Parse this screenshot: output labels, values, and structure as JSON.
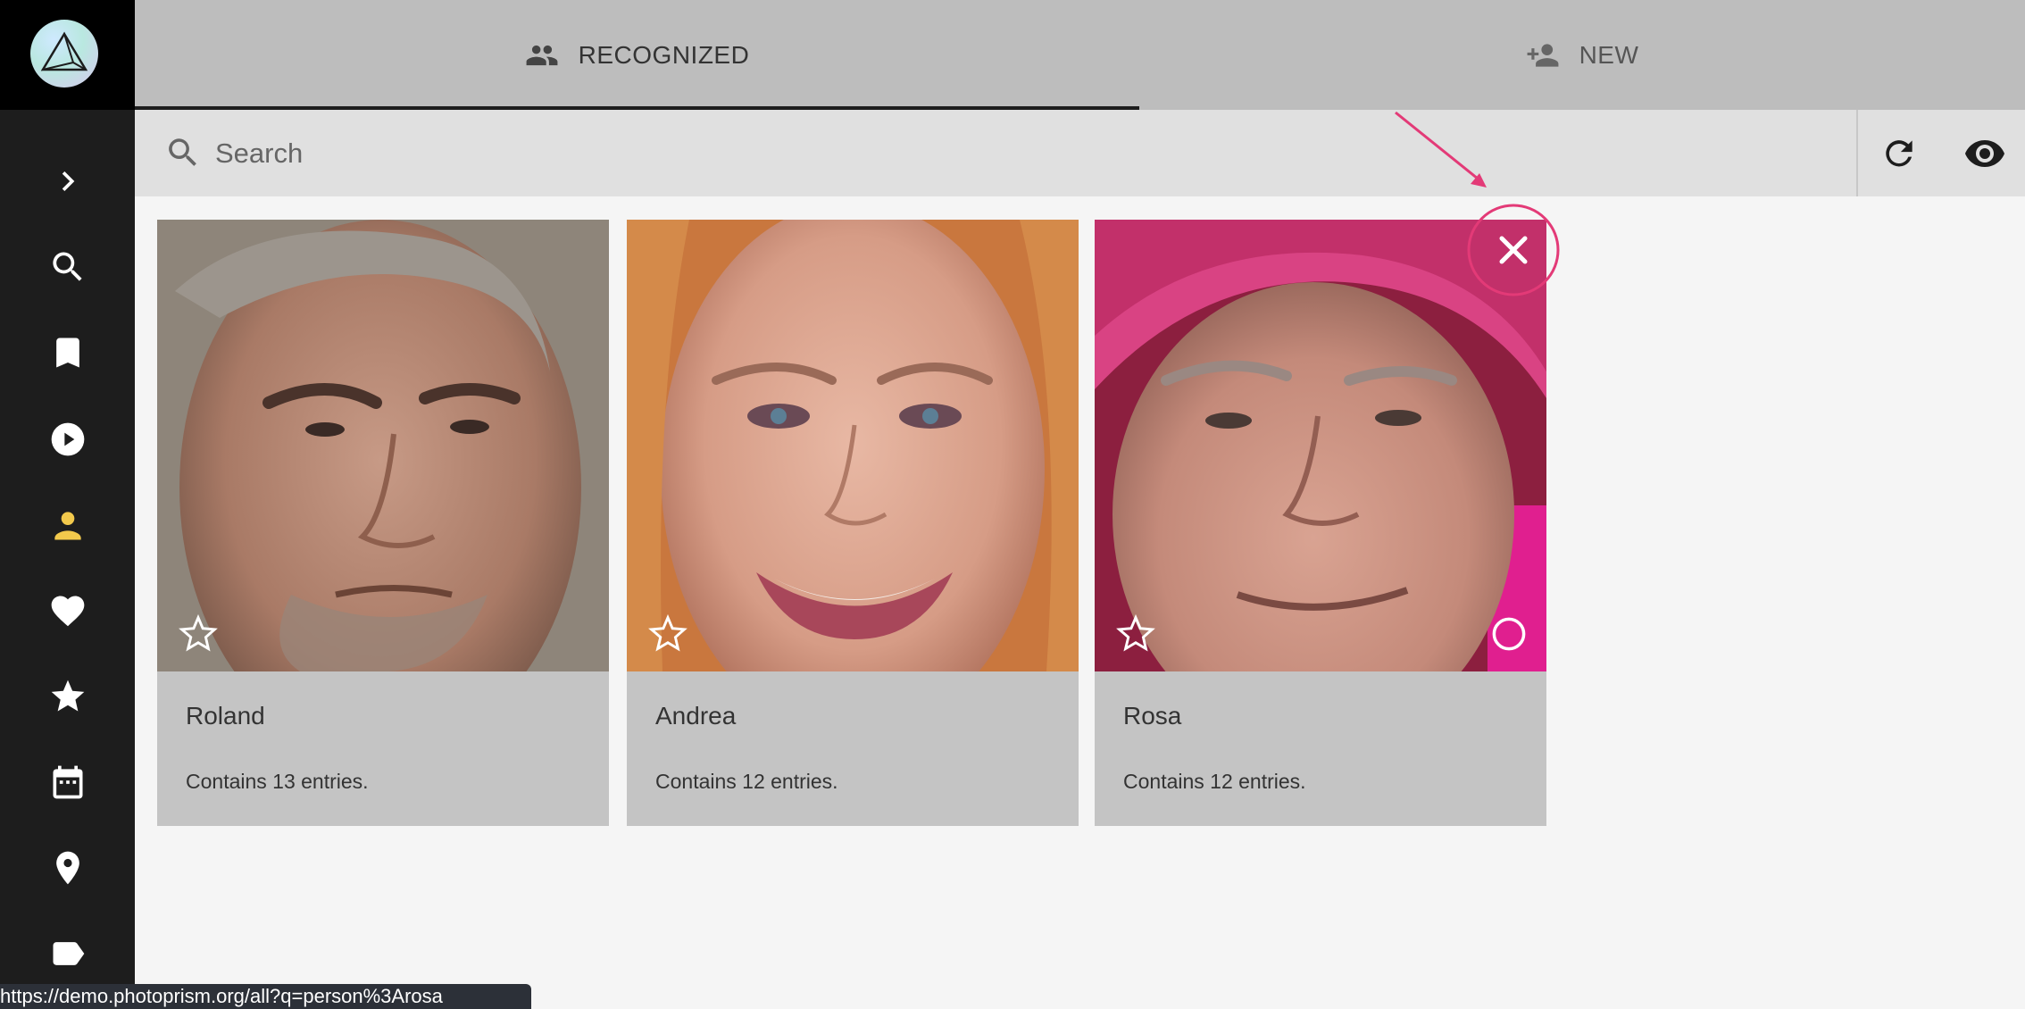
{
  "sidebar": {
    "items": [
      {
        "icon": "chevron-right-icon"
      },
      {
        "icon": "search-icon"
      },
      {
        "icon": "bookmark-icon"
      },
      {
        "icon": "play-circle-icon"
      },
      {
        "icon": "person-icon",
        "active": true
      },
      {
        "icon": "heart-icon"
      },
      {
        "icon": "star-icon"
      },
      {
        "icon": "calendar-icon"
      },
      {
        "icon": "map-pin-icon"
      },
      {
        "icon": "label-icon"
      }
    ],
    "active_color": "#f2c94c"
  },
  "tabs": [
    {
      "label": "RECOGNIZED",
      "icon": "people-icon",
      "active": true
    },
    {
      "label": "NEW",
      "icon": "person-add-icon",
      "active": false
    }
  ],
  "search": {
    "placeholder": "Search",
    "value": ""
  },
  "toolbar": {
    "buttons": [
      {
        "icon": "refresh-icon"
      },
      {
        "icon": "eye-icon"
      }
    ]
  },
  "people": [
    {
      "name": "Roland",
      "count_text": "Contains 13 entries."
    },
    {
      "name": "Andrea",
      "count_text": "Contains 12 entries."
    },
    {
      "name": "Rosa",
      "count_text": "Contains 12 entries."
    }
  ],
  "highlight_color": "#e33a77",
  "status_url": "https://demo.photoprism.org/all?q=person%3Arosa"
}
